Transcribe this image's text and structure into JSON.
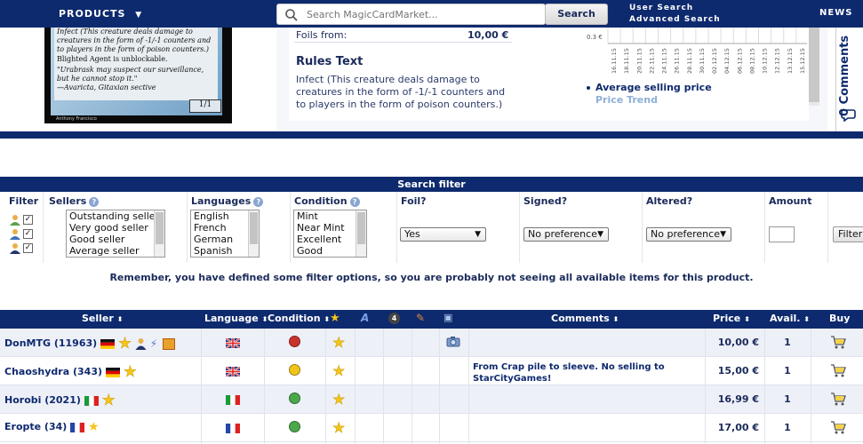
{
  "nav": {
    "products": "PRODUCTS",
    "products_arrow": "▼",
    "search_placeholder": "Search MagicCardMarket...",
    "search_button": "Search",
    "user_search": "User Search",
    "advanced_search": "Advanced Search",
    "news": "NEWS"
  },
  "card": {
    "lines": [
      "Infect (This creature deals damage to",
      "creatures in the form of -1/-1 counters and",
      "to players in the form of poison counters.)",
      "Blighted Agent is unblockable.",
      "\"Urabrask may suspect our surveillance,",
      "but he cannot stop it.\"",
      "—Avaricta, Gitaxian sective"
    ],
    "pt": "1/1",
    "artist": "Anthony Francisco"
  },
  "product": {
    "foils_label": "Foils from:",
    "foils_value": "10,00 €",
    "rules_title": "Rules Text",
    "rules_text": "Infect (This creature deals damage to creatures in the form of -1/-1 counters and to players in the form of poison counters.)",
    "chart_ylabel": "0.3 €",
    "legend_avg": "Average selling price",
    "legend_trend": "Price Trend"
  },
  "comments_tab": "0 Comments",
  "filter": {
    "title": "Search filter",
    "cols": {
      "filter": "Filter",
      "sellers": "Sellers",
      "languages": "Languages",
      "condition": "Condition",
      "foil": "Foil?",
      "signed": "Signed?",
      "altered": "Altered?",
      "amount": "Amount"
    },
    "sellers": [
      "Outstanding seller",
      "Very good seller",
      "Good seller",
      "Average seller"
    ],
    "languages": [
      "English",
      "French",
      "German",
      "Spanish"
    ],
    "conditions": [
      "Mint",
      "Near Mint",
      "Excellent",
      "Good"
    ],
    "foil_value": "Yes",
    "signed_value": "No preference",
    "altered_value": "No preference",
    "filter_button": "Filter"
  },
  "remember": "Remember, you have defined some filter options, so you are probably not seeing all available items for this product.",
  "table": {
    "headers": {
      "seller": "Seller",
      "language": "Language",
      "condition": "Condition",
      "comments": "Comments",
      "price": "Price",
      "avail": "Avail.",
      "buy": "Buy"
    },
    "sort_glyph": "⬍",
    "rows": [
      {
        "seller": "DonMTG (11963)",
        "comment": "",
        "price": "10,00 €",
        "avail": "1"
      },
      {
        "seller": "Chaoshydra (343)",
        "comment": "From Crap pile to sleeve. No selling to StarCityGames!",
        "price": "15,00 €",
        "avail": "1"
      },
      {
        "seller": "Horobi (2021)",
        "comment": "",
        "price": "16,99 €",
        "avail": "1"
      },
      {
        "seller": "Eropte (34)",
        "comment": "",
        "price": "17,00 €",
        "avail": "1"
      }
    ]
  },
  "chart_dates": [
    "16.11.15",
    "18.11.15",
    "20.11.15",
    "22.11.15",
    "24.11.15",
    "26.11.15",
    "28.11.15",
    "30.11.15",
    "02.12.15",
    "04.12.15",
    "06.12.15",
    "08.12.15",
    "10.12.15",
    "12.12.15",
    "13.12.15",
    "15.12.15"
  ]
}
